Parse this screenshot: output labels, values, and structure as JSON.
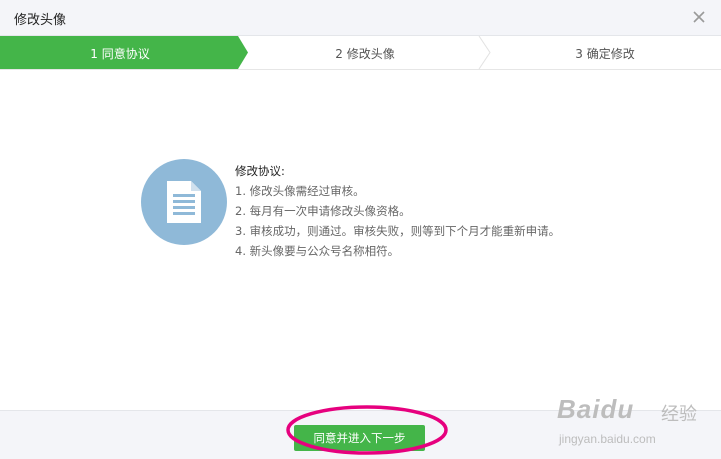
{
  "window": {
    "title": "修改头像"
  },
  "steps": [
    {
      "label": "1 同意协议",
      "active": true
    },
    {
      "label": "2 修改头像",
      "active": false
    },
    {
      "label": "3 确定修改",
      "active": false
    }
  ],
  "agreement": {
    "heading": "修改协议:",
    "items": [
      "1. 修改头像需经过审核。",
      "2. 每月有一次申请修改头像资格。",
      "3. 审核成功，则通过。审核失败，则等到下个月才能重新申请。",
      "4. 新头像要与公众号名称相符。"
    ]
  },
  "footer": {
    "next_label": "同意并进入下一步"
  },
  "watermark": {
    "brand": "Baidu",
    "cn": "经验",
    "url": "jingyan.baidu.com"
  },
  "colors": {
    "accent": "#44b549",
    "highlight": "#e6007e",
    "doc_circle": "#8fb9d8"
  }
}
